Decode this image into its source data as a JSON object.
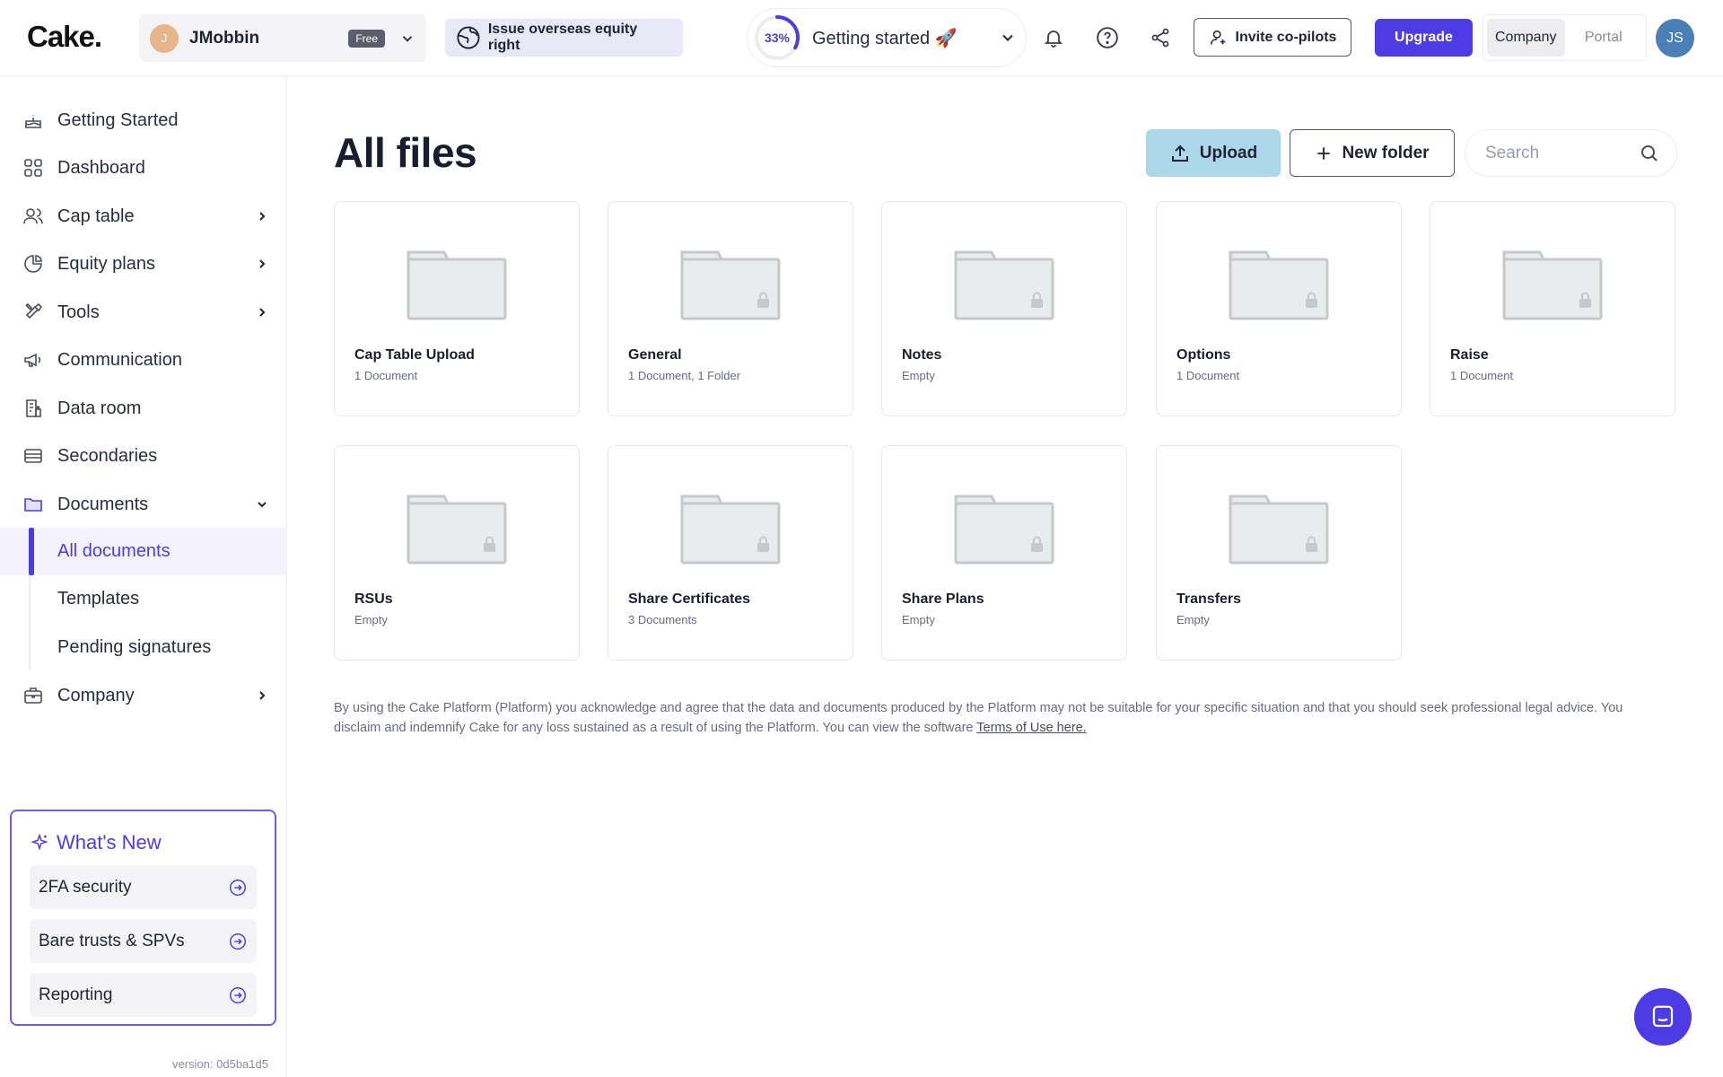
{
  "brand": {
    "logo": "Cake."
  },
  "header": {
    "company_name": "JMobbin",
    "company_initial": "J",
    "plan_badge": "Free",
    "issue_pill": "Issue overseas equity right",
    "progress_percent": 33,
    "progress_label": "33%",
    "getting_started": "Getting started 🚀",
    "invite_label": "Invite co-pilots",
    "upgrade_label": "Upgrade",
    "segments": [
      "Company",
      "Portal"
    ],
    "active_segment": "Company",
    "user_initials": "JS"
  },
  "sidebar": {
    "items": [
      {
        "label": "Getting Started",
        "icon": "cake-icon"
      },
      {
        "label": "Dashboard",
        "icon": "grid-icon"
      },
      {
        "label": "Cap table",
        "icon": "users-icon"
      },
      {
        "label": "Equity plans",
        "icon": "pie-chart-icon"
      },
      {
        "label": "Tools",
        "icon": "tools-icon"
      },
      {
        "label": "Communication",
        "icon": "megaphone-icon"
      },
      {
        "label": "Data room",
        "icon": "data-room-icon"
      },
      {
        "label": "Secondaries",
        "icon": "secondaries-icon"
      },
      {
        "label": "Documents",
        "icon": "folder-icon"
      },
      {
        "label": "Company",
        "icon": "briefcase-icon"
      }
    ],
    "documents_sub": [
      "All documents",
      "Templates",
      "Pending signatures"
    ],
    "active_sub": "All documents",
    "whats_new": {
      "title": "What's New",
      "items": [
        "2FA security",
        "Bare trusts & SPVs",
        "Reporting"
      ]
    },
    "version": "version: 0d5ba1d5"
  },
  "main": {
    "title": "All files",
    "upload_label": "Upload",
    "new_folder_label": "New folder",
    "search_placeholder": "Search",
    "folders": [
      {
        "name": "Cap Table Upload",
        "meta": "1 Document",
        "locked": false
      },
      {
        "name": "General",
        "meta": "1 Document, 1 Folder",
        "locked": true
      },
      {
        "name": "Notes",
        "meta": "Empty",
        "locked": true
      },
      {
        "name": "Options",
        "meta": "1 Document",
        "locked": true
      },
      {
        "name": "Raise",
        "meta": "1 Document",
        "locked": true
      },
      {
        "name": "RSUs",
        "meta": "Empty",
        "locked": true
      },
      {
        "name": "Share Certificates",
        "meta": "3 Documents",
        "locked": true
      },
      {
        "name": "Share Plans",
        "meta": "Empty",
        "locked": true
      },
      {
        "name": "Transfers",
        "meta": "Empty",
        "locked": true
      }
    ],
    "disclaimer": "By using the Cake Platform (Platform) you acknowledge and agree that the data and documents produced by the Platform may not be suitable for your specific situation and that you should seek professional legal advice. You disclaim and indemnify Cake for any loss sustained as a result of using the Platform. You can view the software ",
    "terms_link": "Terms of Use here."
  },
  "colors": {
    "accent": "#4d3ce6",
    "upload_bg": "#add8ec",
    "folder_fill": "#e9ecec",
    "folder_stroke": "#c6c9cc"
  }
}
